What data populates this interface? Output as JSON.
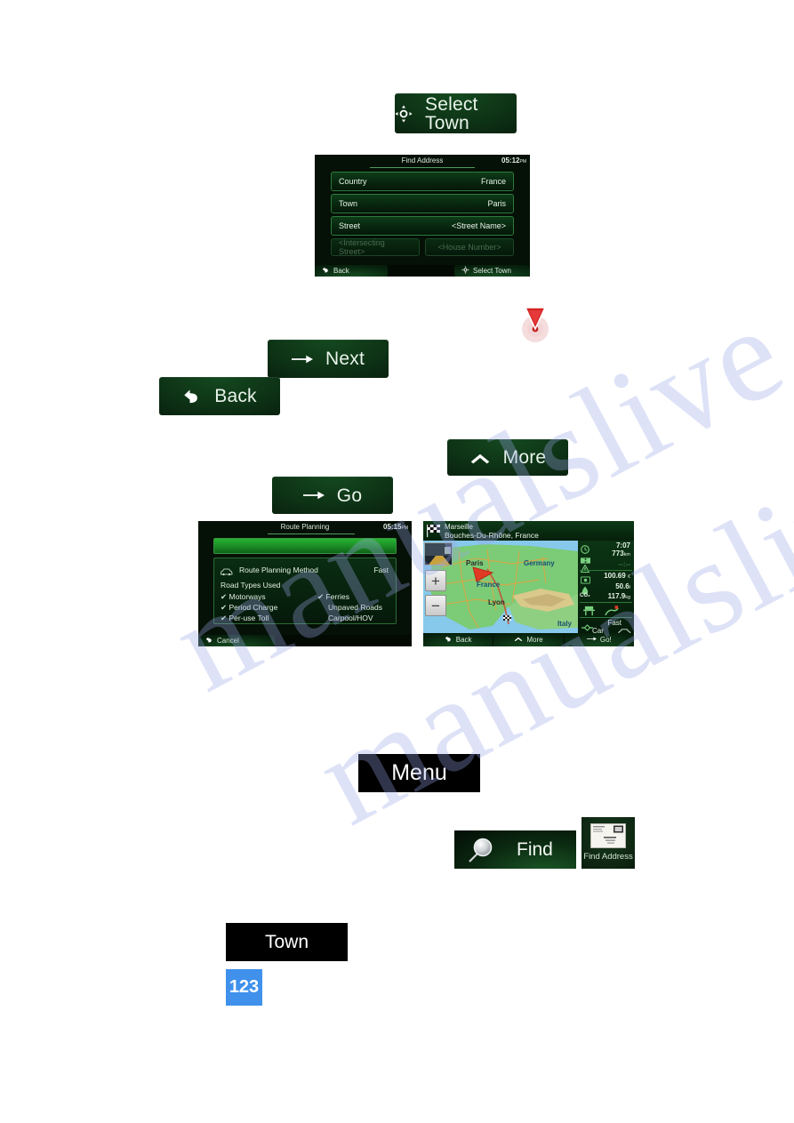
{
  "document": {
    "page_number": "123",
    "watermark": "manualslive.com"
  },
  "buttons": {
    "select_town": {
      "label": "Select Town",
      "icon": "crosshair-icon"
    },
    "next": {
      "label": "Next",
      "icon": "arrow-right-icon"
    },
    "back": {
      "label": "Back",
      "icon": "arrow-back-icon"
    },
    "more": {
      "label": "More",
      "icon": "chevron-up-icon"
    },
    "go": {
      "label": "Go",
      "icon": "arrow-right-icon"
    },
    "menu": {
      "label": "Menu"
    },
    "find": {
      "label": "Find",
      "icon": "magnifier-icon"
    },
    "find_address_tile": {
      "label": "Find Address",
      "icon": "envelope-icon"
    },
    "town": {
      "label": "Town"
    }
  },
  "marker": {
    "name": "red-pin-marker",
    "color": "#d42222"
  },
  "screens": {
    "find_address": {
      "title": "Find Address",
      "clock": "05:12",
      "clock_suffix": "PM",
      "rows": [
        {
          "label": "Country",
          "value": "France",
          "enabled": true
        },
        {
          "label": "Town",
          "value": "Paris",
          "enabled": true
        },
        {
          "label": "Street",
          "value": "<Street Name>",
          "enabled": true
        }
      ],
      "disabled_rows": [
        {
          "value": "<Intersecting Street>"
        },
        {
          "value": "<House Number>"
        }
      ],
      "bottom_bar": [
        {
          "label": "Back",
          "icon": "arrow-back-icon"
        },
        {
          "label": "Select Town",
          "icon": "crosshair-icon"
        }
      ]
    },
    "route_planning": {
      "title": "Route Planning",
      "clock": "05:15",
      "clock_suffix": "PM",
      "method_label": "Route Planning Method",
      "method_value": "Fast",
      "method_icon": "car-icon",
      "road_types_label": "Road Types Used",
      "road_types": [
        {
          "label": "Motorways",
          "checked": true
        },
        {
          "label": "Period Charge",
          "checked": true
        },
        {
          "label": "Per-use Toll",
          "checked": true
        },
        {
          "label": "Ferries",
          "checked": true
        },
        {
          "label": "Unpaved Roads",
          "checked": false
        },
        {
          "label": "Carpool/HOV",
          "checked": false
        }
      ],
      "bottom_bar": [
        {
          "label": "Cancel",
          "icon": "arrow-back-icon"
        }
      ]
    },
    "route_summary": {
      "destination_name": "Marseille",
      "destination_region": "Bouches-Du-Rhône, France",
      "destination_icon": "checkered-flag-icon",
      "map_labels": [
        "Paris",
        "Germany",
        "France",
        "Lyon",
        "Italy"
      ],
      "stats": [
        {
          "icon": "clock-icon",
          "value": "7:07",
          "unit": ""
        },
        {
          "icon": "road-icon",
          "value": "773",
          "unit": "km"
        },
        {
          "icon": "warning-icon",
          "value": "--:--",
          "unit": ""
        },
        {
          "icon": "money-icon",
          "value": "100.69",
          "unit": "€"
        },
        {
          "icon": "fuel-icon",
          "value": "50.6",
          "unit": "l"
        },
        {
          "icon": "co2-icon",
          "value": "117.9",
          "unit": "kg"
        }
      ],
      "method_value": "Fast",
      "method_icon": "route-icon",
      "vehicle_value": "Car",
      "vehicle_icon": "car-icon",
      "zoom_in": "+",
      "zoom_out": "−",
      "bottom_bar": [
        {
          "label": "Back",
          "icon": "arrow-back-icon"
        },
        {
          "label": "More",
          "icon": "chevron-up-icon"
        },
        {
          "label": "Go!",
          "icon": "arrow-right-icon"
        }
      ]
    }
  }
}
